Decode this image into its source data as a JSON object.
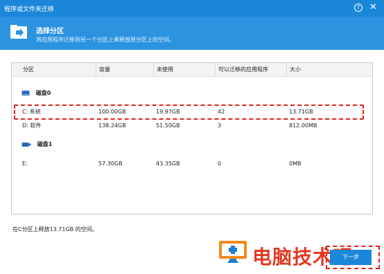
{
  "window": {
    "title": "程序或文件夹迁移",
    "help_label": "?",
    "close_label": "✕"
  },
  "header": {
    "title": "选择分区",
    "subtitle": "将应用程序迁移到另一个分区上来释放原分区上的空间。"
  },
  "table": {
    "columns": [
      "分区",
      "容量",
      "未使用",
      "可以迁移的应用程序",
      "大小"
    ],
    "disks": [
      {
        "label": "磁盘0",
        "rows": [
          {
            "partition": "C: 系统",
            "capacity": "100.00GB",
            "free": "19.97GB",
            "apps": "42",
            "size": "13.71GB",
            "selected": true
          },
          {
            "partition": "D: 软件",
            "capacity": "138.24GB",
            "free": "51.50GB",
            "apps": "3",
            "size": "812.00MB",
            "selected": false
          }
        ]
      },
      {
        "label": "磁盘1",
        "rows": [
          {
            "partition": "E:",
            "capacity": "57.30GB",
            "free": "43.35GB",
            "apps": "0",
            "size": "0MB",
            "selected": false
          }
        ]
      }
    ]
  },
  "status": "在C分区上释放13.71GB 的空间。",
  "watermark": "电脑技术吧",
  "next_button": "下一步",
  "colors": {
    "titlebar": "#1a87d8",
    "header": "#2b93e0",
    "selection": "#e0211b",
    "watermark": "#e23a22"
  }
}
